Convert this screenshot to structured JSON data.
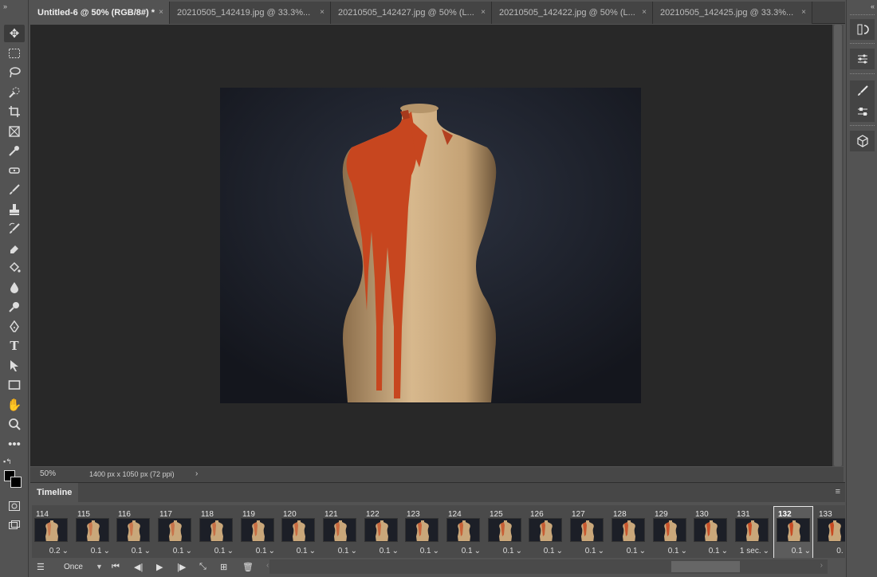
{
  "tabs": [
    {
      "title": "Untitled-6 @ 50% (RGB/8#) *",
      "active": true
    },
    {
      "title": "20210505_142419.jpg @ 33.3%...",
      "active": false
    },
    {
      "title": "20210505_142427.jpg @ 50% (L...",
      "active": false
    },
    {
      "title": "20210505_142422.jpg @ 50% (L...",
      "active": false
    },
    {
      "title": "20210505_142425.jpg @ 33.3%...",
      "active": false
    }
  ],
  "tab_close": "×",
  "status": {
    "zoom": "50%",
    "doc_info": "1400 px x 1050 px (72 ppi)",
    "arrow": "›"
  },
  "timeline": {
    "title": "Timeline",
    "loop": "Once",
    "frames": [
      {
        "num": "114",
        "delay": "0.2"
      },
      {
        "num": "115",
        "delay": "0.1"
      },
      {
        "num": "116",
        "delay": "0.1"
      },
      {
        "num": "117",
        "delay": "0.1"
      },
      {
        "num": "118",
        "delay": "0.1"
      },
      {
        "num": "119",
        "delay": "0.1"
      },
      {
        "num": "120",
        "delay": "0.1"
      },
      {
        "num": "121",
        "delay": "0.1"
      },
      {
        "num": "122",
        "delay": "0.1"
      },
      {
        "num": "123",
        "delay": "0.1"
      },
      {
        "num": "124",
        "delay": "0.1"
      },
      {
        "num": "125",
        "delay": "0.1"
      },
      {
        "num": "126",
        "delay": "0.1"
      },
      {
        "num": "127",
        "delay": "0.1"
      },
      {
        "num": "128",
        "delay": "0.1"
      },
      {
        "num": "129",
        "delay": "0.1"
      },
      {
        "num": "130",
        "delay": "0.1"
      },
      {
        "num": "131",
        "delay": "1 sec."
      },
      {
        "num": "132",
        "delay": "0.1",
        "selected": true
      },
      {
        "num": "133",
        "delay": "0."
      }
    ]
  },
  "icons": {
    "move": "move-icon",
    "marquee": "rect-marquee-icon",
    "lasso": "lasso-icon",
    "quick-select": "quick-select-icon",
    "crop": "crop-icon",
    "frame": "frame-icon",
    "eyedropper": "eyedropper-icon",
    "healing": "healing-brush-icon",
    "brush": "brush-icon",
    "stamp": "clone-stamp-icon",
    "history-brush": "history-brush-icon",
    "eraser": "eraser-icon",
    "bucket": "paint-bucket-icon",
    "blur": "blur-icon",
    "dodge": "dodge-icon",
    "pen": "pen-icon",
    "type": "type-icon",
    "path-select": "path-select-icon",
    "shape": "rectangle-icon",
    "hand": "hand-icon",
    "zoom": "zoom-icon",
    "more": "more-icon"
  },
  "colors": {
    "accent_paint": "#c7461f",
    "mannequin": "#c9a77a",
    "background": "#1b1e26"
  }
}
